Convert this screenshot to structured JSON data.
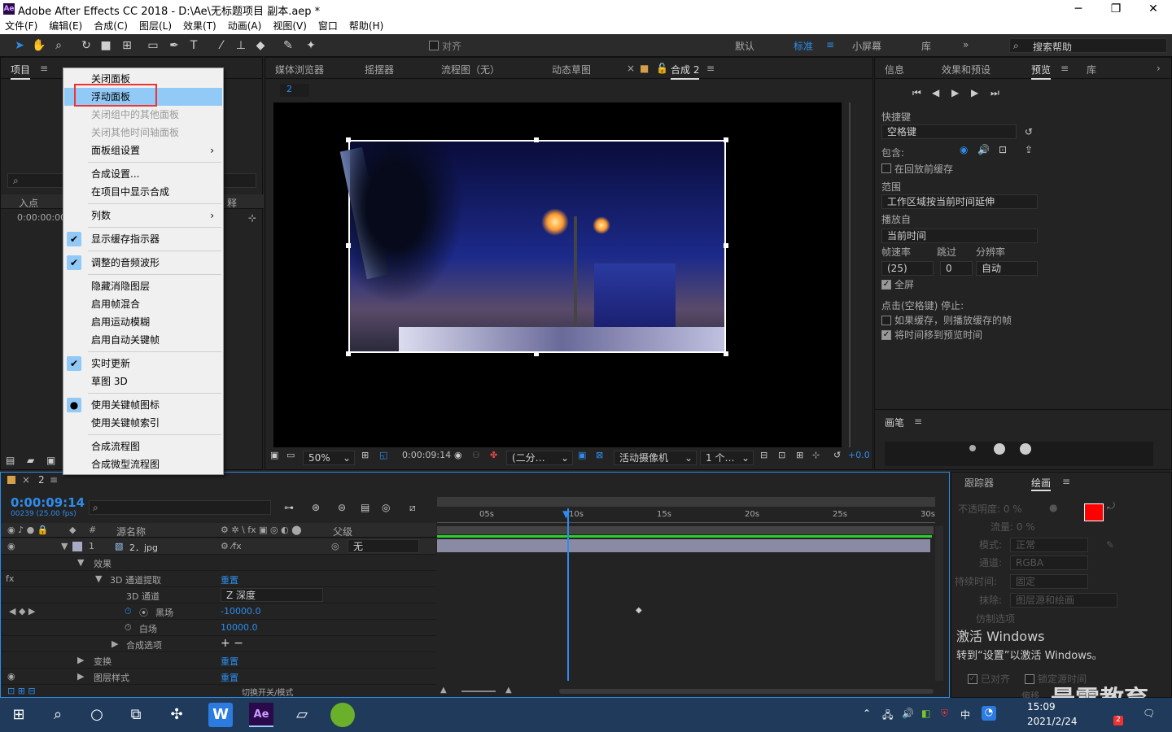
{
  "window": {
    "title": "Adobe After Effects CC 2018 - D:\\Ae\\无标题项目 副本.aep *",
    "logo": "Ae",
    "minimize": "─",
    "maximize": "❐",
    "close": "✕"
  },
  "menubar": [
    "文件(F)",
    "编辑(E)",
    "合成(C)",
    "图层(L)",
    "效果(T)",
    "动画(A)",
    "视图(V)",
    "窗口",
    "帮助(H)"
  ],
  "toolbar": {
    "snap_label": "对齐",
    "workspaces": [
      "默认",
      "标准",
      "小屏幕",
      "库"
    ],
    "search_placeholder": "搜索帮助"
  },
  "project_panel": {
    "tab": "项目",
    "col_in": "入点",
    "col_time": "0:00:00:00",
    "col_comment": "释"
  },
  "context_menu": {
    "items": [
      {
        "label": "关闭面板"
      },
      {
        "label": "浮动面板",
        "highlight": true
      },
      {
        "label": "关闭组中的其他面板",
        "disabled": true
      },
      {
        "label": "关闭其他时间轴面板",
        "disabled": true
      },
      {
        "label": "面板组设置",
        "submenu": "›"
      },
      {
        "label": "合成设置..."
      },
      {
        "label": "在项目中显示合成"
      },
      {
        "label": "列数",
        "submenu": "›"
      },
      {
        "label": "显示缓存指示器",
        "check": "✔"
      },
      {
        "label": "调整的音频波形",
        "check": "✔"
      },
      {
        "label": "隐藏消隐图层"
      },
      {
        "label": "启用帧混合"
      },
      {
        "label": "启用运动模糊"
      },
      {
        "label": "启用自动关键帧"
      },
      {
        "label": "实时更新",
        "check": "✔"
      },
      {
        "label": "草图 3D"
      },
      {
        "label": "使用关键帧图标",
        "check": "●"
      },
      {
        "label": "使用关键帧索引"
      },
      {
        "label": "合成流程图"
      },
      {
        "label": "合成微型流程图"
      }
    ]
  },
  "viewer": {
    "tabs": [
      "媒体浏览器",
      "摇摆器",
      "流程图（无）",
      "动态草图",
      "合成 2"
    ],
    "comp_tab_index": "2",
    "zoom": "50%",
    "timecode": "0:00:09:14",
    "resolution": "(二分…",
    "camera": "活动摄像机",
    "views": "1 个…",
    "exposure": "+0.0"
  },
  "right_panel": {
    "tabs": [
      "信息",
      "效果和预设",
      "预览",
      "库",
      "›"
    ],
    "shortcut_label": "快捷键",
    "shortcut_value": "空格键",
    "include_label": "包含:",
    "cache_before": "在回放前缓存",
    "range_label": "范围",
    "range_value": "工作区域按当前时间延伸",
    "play_from_label": "播放自",
    "play_from_value": "当前时间",
    "fps_label": "帧速率",
    "skip_label": "跳过",
    "res_label": "分辨率",
    "fps_value": "(25)",
    "skip_value": "0",
    "res_value": "自动",
    "fullscreen": "全屏",
    "stop_label": "点击(空格键) 停止:",
    "stop_opt1": "如果缓存，则播放缓存的帧",
    "stop_opt2": "将时间移到预览时间",
    "brush_tab": "画笔"
  },
  "timeline": {
    "tab": "2",
    "timecode": "0:00:09:14",
    "frames": "00239 (25.00 fps)",
    "col_source": "源名称",
    "col_parent": "父级",
    "ruler": [
      "05s",
      "10s",
      "15s",
      "20s",
      "25s",
      "30s"
    ],
    "layer": {
      "num": "1",
      "name": "2．jpg",
      "parent": "无"
    },
    "rows": [
      {
        "label": "效果"
      },
      {
        "label": "3D 通道提取",
        "value": "重置"
      },
      {
        "label": "3D 通道",
        "value": "Z 深度"
      },
      {
        "label": "黑场",
        "value": "-10000.0"
      },
      {
        "label": "白场",
        "value": "10000.0"
      },
      {
        "label": "合成选项",
        "value": "+ −"
      },
      {
        "label": "变换",
        "value": "重置"
      },
      {
        "label": "图层样式",
        "value": "重置"
      }
    ],
    "toggle_label": "切换开关/模式"
  },
  "tracker_panel": {
    "tabs": [
      "跟踪器",
      "绘画"
    ],
    "opacity": "不透明度: 0 %",
    "flow": "流量: 0 %",
    "mode_label": "模式:",
    "mode_value": "正常",
    "channel_label": "通道:",
    "channel_value": "RGBA",
    "duration_label": "持续时间:",
    "duration_value": "固定",
    "erase_label": "抹除:",
    "erase_value": "图层源和绘画",
    "clone_label": "仿制选项",
    "aligned": "已对齐",
    "lock_time": "锁定源时间",
    "offset": "偏移"
  },
  "watermark": {
    "line1": "激活 Windows",
    "line2": "转到“设置”以激活 Windows。",
    "brand": "最需教育"
  },
  "taskbar": {
    "time": "15:09",
    "date": "2021/2/24",
    "ime": "中",
    "badge": "2"
  },
  "colors": {
    "accent": "#2d8ceb",
    "highlight": "#91c9f7",
    "paint_fg": "#ff0000"
  }
}
